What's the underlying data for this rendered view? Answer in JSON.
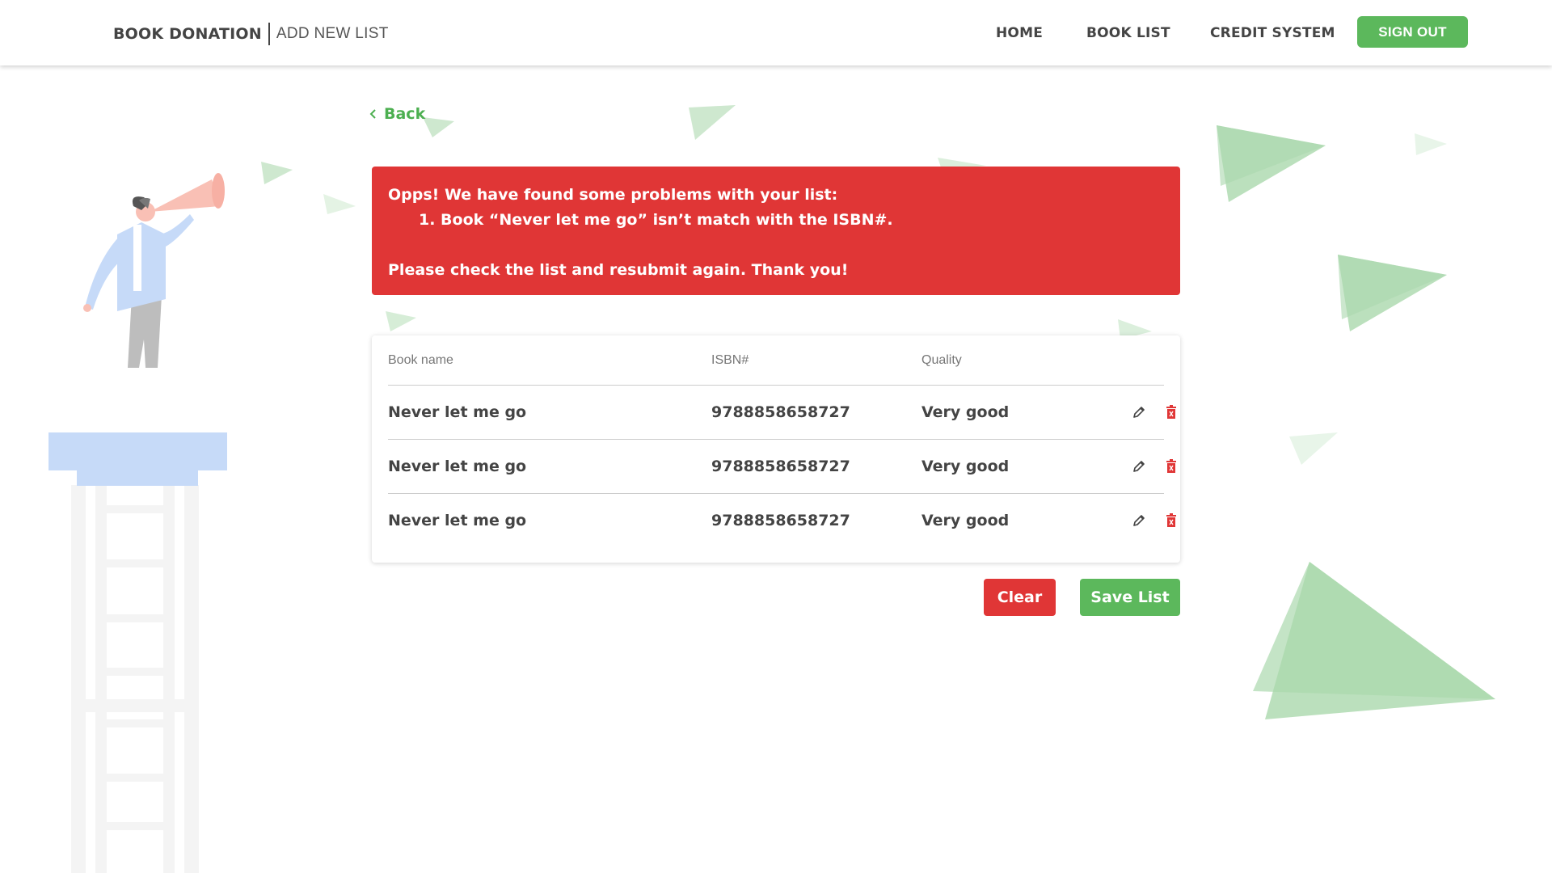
{
  "header": {
    "brand": "BOOK DONATION",
    "subtitle": "ADD NEW LIST",
    "nav": [
      {
        "label": "HOME"
      },
      {
        "label": "BOOK LIST"
      },
      {
        "label": "CREDIT SYSTEM"
      }
    ],
    "sign_out": "SIGN OUT"
  },
  "back": {
    "label": "Back",
    "icon": "chevron-left-icon"
  },
  "alert": {
    "title": "Opps! We have found some problems with your list:",
    "items": [
      "1. Book “Never let me go” isn’t match with the ISBN#."
    ],
    "footer": "Please check the list and resubmit again. Thank you!"
  },
  "table": {
    "columns": [
      "Book name",
      "ISBN#",
      "Quality"
    ],
    "rows": [
      {
        "name": "Never let me go",
        "isbn": "9788858658727",
        "quality": "Very good"
      },
      {
        "name": "Never let me go",
        "isbn": "9788858658727",
        "quality": "Very good"
      },
      {
        "name": "Never let me go",
        "isbn": "9788858658727",
        "quality": "Very good"
      }
    ],
    "row_actions": [
      "pencil-icon",
      "trash-icon"
    ]
  },
  "actions": {
    "clear": "Clear",
    "save": "Save List"
  },
  "colors": {
    "accent_green": "#5cb85c",
    "link_green": "#4caf50",
    "alert_red": "#e03636",
    "plane_green": "#a5d6a7",
    "text_dark": "#444444"
  }
}
